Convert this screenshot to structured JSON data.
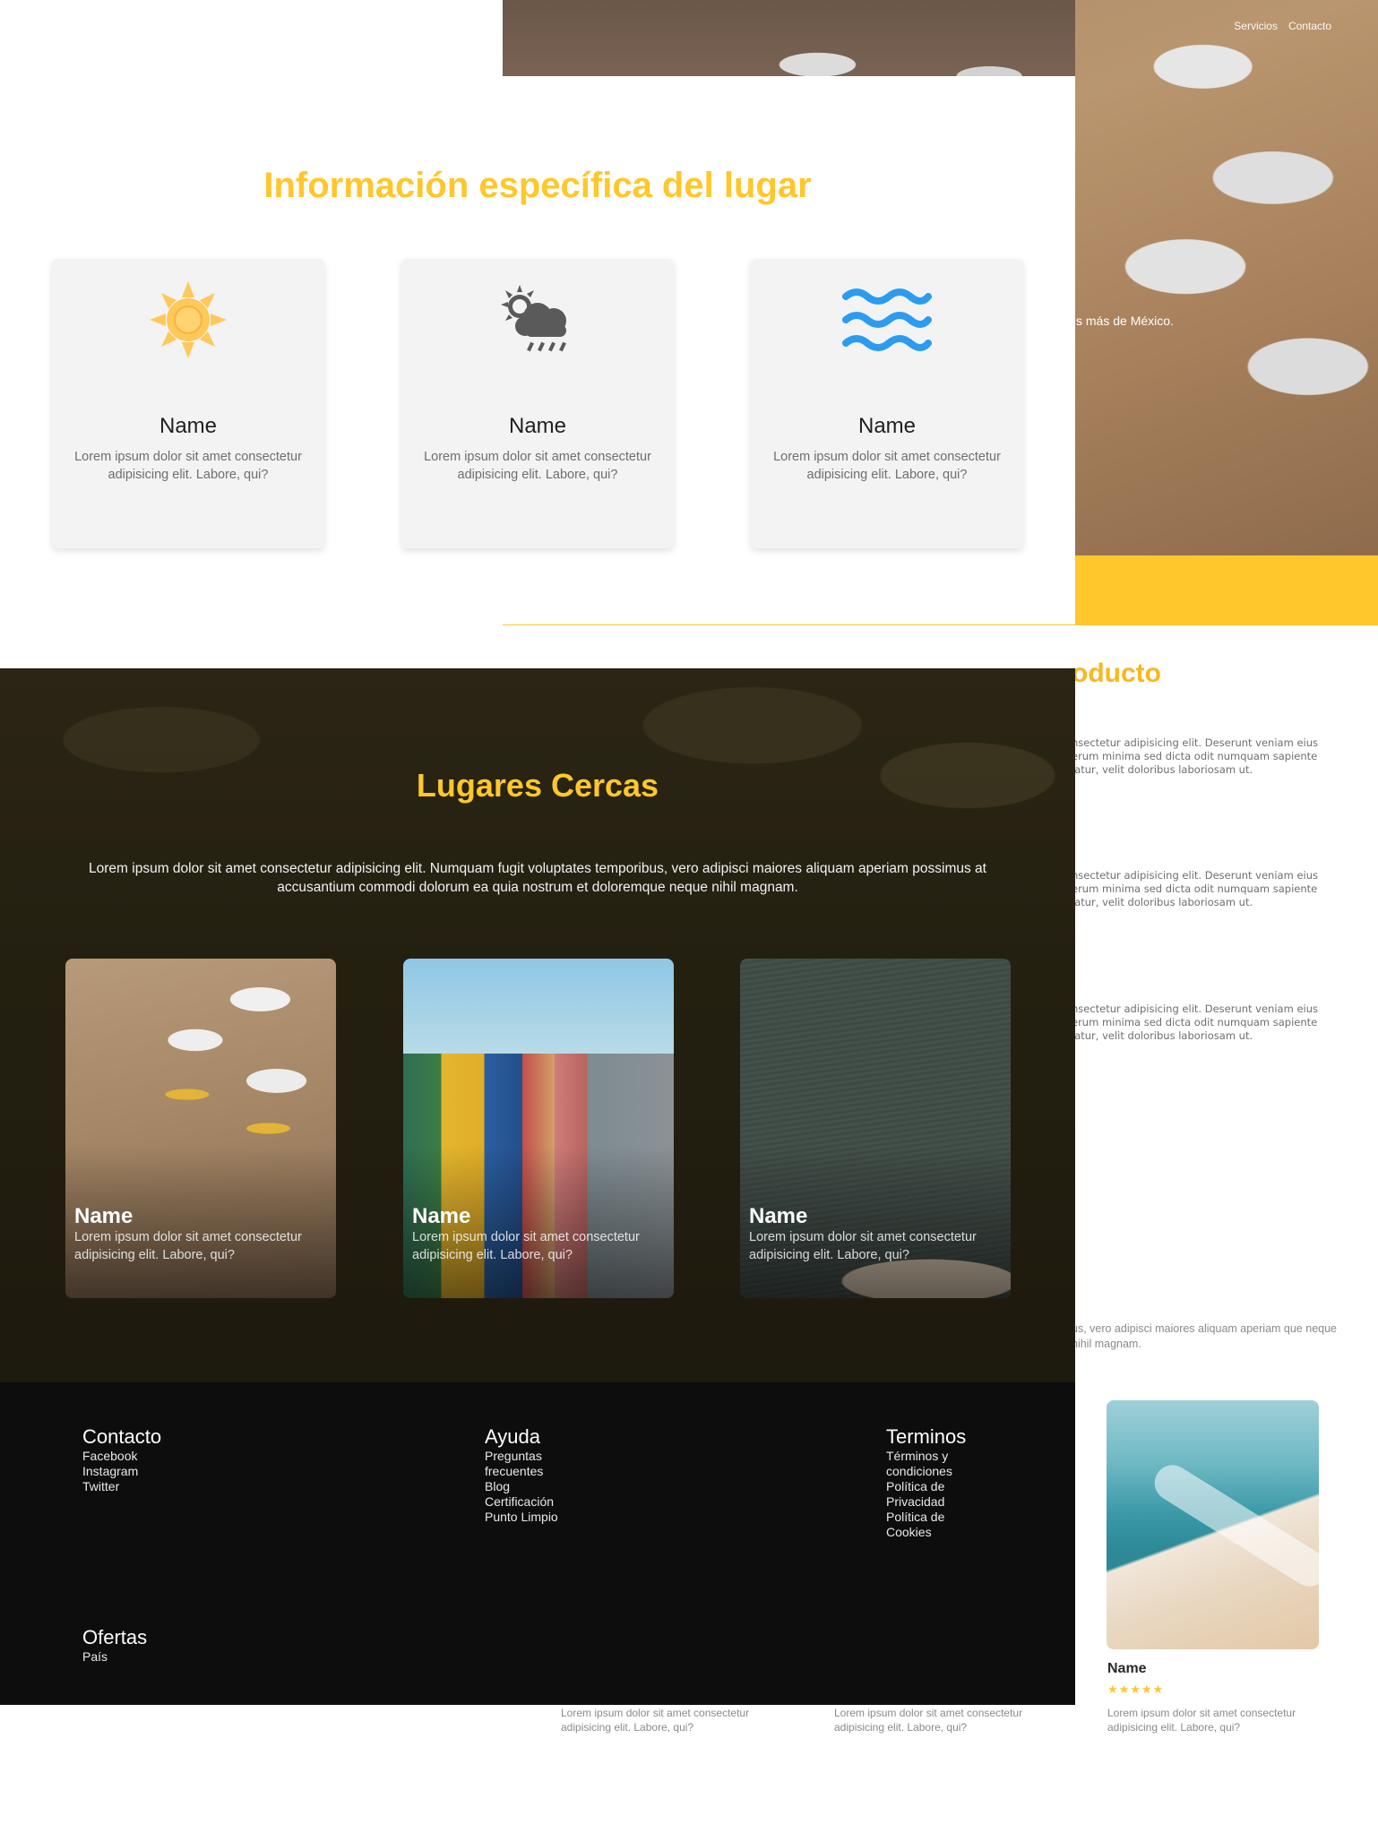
{
  "colors": {
    "accent": "#ffc72c",
    "dark_section": "#231f10",
    "footer": "#0d0d0d"
  },
  "background_page": {
    "nav": [
      "Servicios",
      "Contacto"
    ],
    "hero_tagline": "s más de México.",
    "section_title": "oducto",
    "paragraphs": [
      "nsectetur adipisicing elit. Deserunt veniam eius erum minima sed dicta odit numquam sapiente iatur, velit doloribus laboriosam ut.",
      "nsectetur adipisicing elit. Deserunt veniam eius erum minima sed dicta odit numquam sapiente iatur, velit doloribus laboriosam ut.",
      "nsectetur adipisicing elit. Deserunt veniam eius erum minima sed dicta odit numquam sapiente iatur, velit doloribus laboriosam ut."
    ],
    "long_text": "us, vero adipisci maiores aliquam aperiam que neque nihil magnam.",
    "product": {
      "name": "Name",
      "stars": "★★★★★",
      "rating": 5,
      "description": "Lorem ipsum dolor sit amet consectetur adipisicing elit. Labore, qui?"
    },
    "footer_descriptions": [
      "Lorem ipsum dolor sit amet consectetur adipisicing elit. Labore, qui?",
      "Lorem ipsum dolor sit amet consectetur adipisicing elit. Labore, qui?"
    ]
  },
  "info": {
    "title": "Información específica del lugar",
    "cards": [
      {
        "icon": "sun-icon",
        "name": "Name",
        "desc": "Lorem ipsum dolor sit amet consectetur adipisicing elit. Labore, qui?"
      },
      {
        "icon": "rain-cloud-icon",
        "name": "Name",
        "desc": "Lorem ipsum dolor sit amet consectetur adipisicing elit. Labore, qui?"
      },
      {
        "icon": "waves-icon",
        "name": "Name",
        "desc": "Lorem ipsum dolor sit amet consectetur adipisicing elit. Labore, qui?"
      }
    ]
  },
  "lugares": {
    "title": "Lugares Cercas",
    "text": "Lorem ipsum dolor sit amet consectetur adipisicing elit. Numquam fugit voluptates temporibus, vero adipisci maiores aliquam aperiam possimus at accusantium commodi dolorum ea quia nostrum et doloremque neque nihil magnam.",
    "cards": [
      {
        "name": "Name",
        "desc": "Lorem ipsum dolor sit amet consectetur adipisicing elit. Labore, qui?"
      },
      {
        "name": "Name",
        "desc": "Lorem ipsum dolor sit amet consectetur adipisicing elit. Labore, qui?"
      },
      {
        "name": "Name",
        "desc": "Lorem ipsum dolor sit amet consectetur adipisicing elit. Labore, qui?"
      }
    ]
  },
  "footer": {
    "contacto": {
      "title": "Contacto",
      "links": [
        "Facebook",
        "Instagram",
        "Twitter"
      ]
    },
    "ayuda": {
      "title": "Ayuda",
      "links": [
        "Preguntas frecuentes",
        "Blog",
        "Certificación",
        "Punto Limpio"
      ]
    },
    "terminos": {
      "title": "Terminos",
      "links": [
        "Términos y condiciones",
        "Política de Privacidad",
        "Política de Cookies"
      ]
    },
    "ofertas": {
      "title": "Ofertas",
      "links": [
        "País"
      ]
    }
  }
}
